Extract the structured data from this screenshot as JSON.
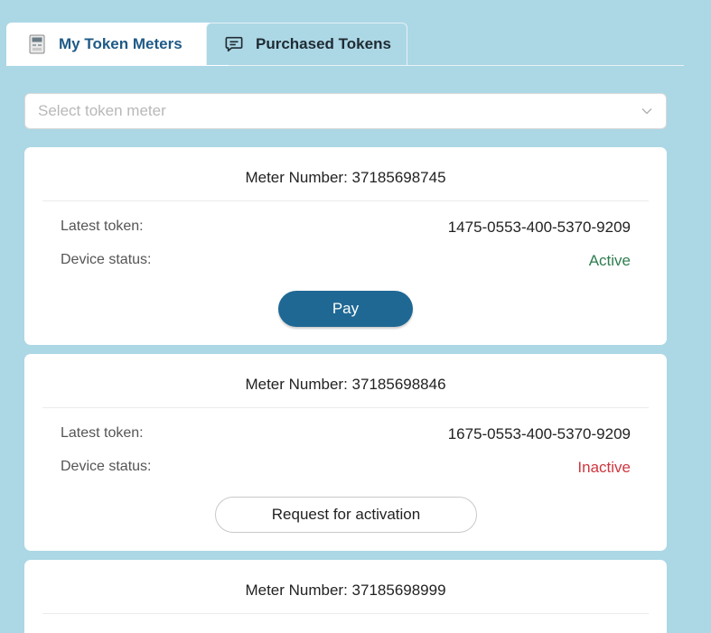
{
  "tabs": [
    {
      "label": "My Token Meters",
      "icon": "meter-icon"
    },
    {
      "label": "Purchased Tokens",
      "icon": "chat-icon"
    }
  ],
  "select": {
    "placeholder": "Select token meter"
  },
  "cards": [
    {
      "meter_label": "Meter Number: 37185698745",
      "token_label": "Latest token:",
      "token_value": "1475-0553-400-5370-9209",
      "status_label": "Device status:",
      "status_value": "Active",
      "action_label": "Pay"
    },
    {
      "meter_label": "Meter Number: 37185698846",
      "token_label": "Latest token:",
      "token_value": "1675-0553-400-5370-9209",
      "status_label": "Device status:",
      "status_value": "Inactive",
      "action_label": "Request for activation"
    },
    {
      "meter_label": "Meter Number: 37185698999"
    }
  ],
  "colors": {
    "background": "#acd7e5",
    "accent": "#1f6894",
    "active": "#2e7d4f",
    "inactive": "#d0363f"
  }
}
